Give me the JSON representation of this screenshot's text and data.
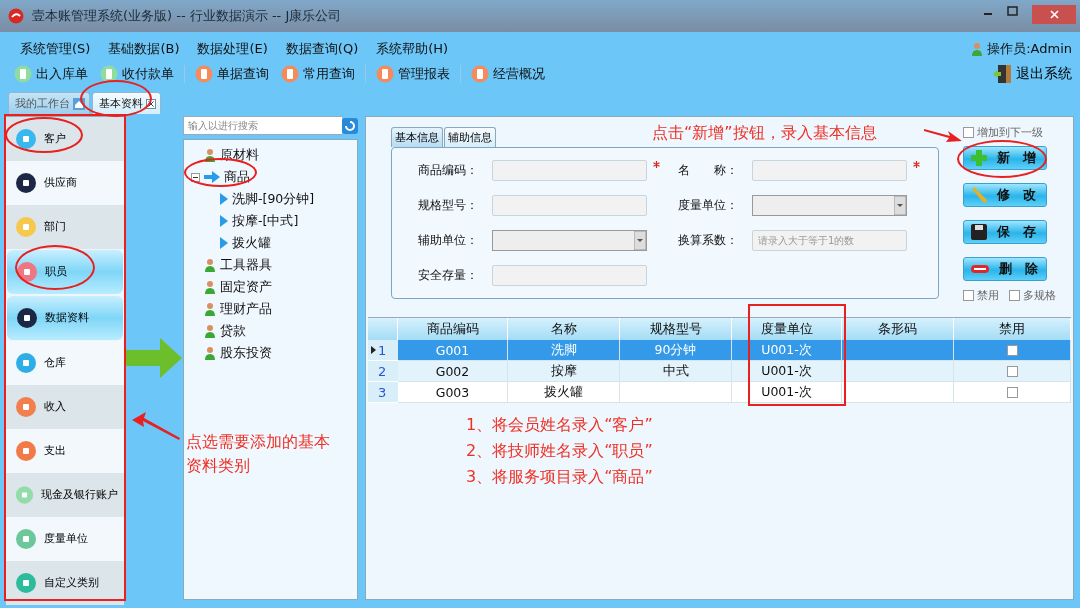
{
  "window": {
    "title": "壹本账管理系统(业务版) -- 行业数据演示 -- J康乐公司"
  },
  "menu": [
    "系统管理(S)",
    "基础数据(B)",
    "数据处理(E)",
    "数据查询(Q)",
    "系统帮助(H)"
  ],
  "toolbar": [
    {
      "label": "出入库单",
      "color": "#8fdca0"
    },
    {
      "label": "收付款单",
      "color": "#8fdca0"
    },
    {
      "label": "单据查询",
      "color": "#f58a5c"
    },
    {
      "label": "常用查询",
      "color": "#f58a5c"
    },
    {
      "label": "管理报表",
      "color": "#f58a5c"
    },
    {
      "label": "经营概况",
      "color": "#f58a5c"
    }
  ],
  "operator": "操作员:Admin",
  "exit": "退出系统",
  "tabs": [
    {
      "label": "我的工作台",
      "selected": false
    },
    {
      "label": "基本资料",
      "selected": true
    }
  ],
  "sidebar": {
    "items": [
      {
        "label": "客户",
        "selected": false,
        "color": "#38b8ee"
      },
      {
        "label": "供应商",
        "selected": false,
        "color": "#1b2745"
      },
      {
        "label": "部门",
        "selected": false,
        "color": "#f6c84c"
      },
      {
        "label": "职员",
        "selected": true,
        "color": "#ef7683"
      },
      {
        "label": "数据资料",
        "selected": true,
        "color": "#1b2745"
      },
      {
        "label": "仓库",
        "selected": false,
        "color": "#2eaee6"
      },
      {
        "label": "收入",
        "selected": false,
        "color": "#f2804e"
      },
      {
        "label": "支出",
        "selected": false,
        "color": "#f27a48"
      },
      {
        "label": "现金及银行账户",
        "selected": false,
        "color": "#92dbaa"
      },
      {
        "label": "度量单位",
        "selected": false,
        "color": "#6cc79a"
      },
      {
        "label": "自定义类别",
        "selected": false,
        "color": "#2dbb9e"
      }
    ]
  },
  "tree": {
    "search_placeholder": "输入以进行搜索",
    "items": [
      {
        "label": "原材料"
      },
      {
        "label": "商品",
        "expanded": true,
        "children": [
          {
            "label": "洗脚-[90分钟]"
          },
          {
            "label": "按摩-[中式]"
          },
          {
            "label": "拨火罐"
          }
        ]
      },
      {
        "label": "工具器具"
      },
      {
        "label": "固定资产"
      },
      {
        "label": "理财产品"
      },
      {
        "label": "贷款"
      },
      {
        "label": "股东投资"
      }
    ]
  },
  "form": {
    "tabs": [
      {
        "label": "基本信息",
        "selected": true
      },
      {
        "label": "辅助信息",
        "selected": false
      }
    ],
    "fields": [
      {
        "label": "商品编码：",
        "kind": "text",
        "required": true
      },
      {
        "label": "名　　称：",
        "kind": "text",
        "required": true
      },
      {
        "label": "规格型号：",
        "kind": "text",
        "required": false
      },
      {
        "label": "度量单位：",
        "kind": "select",
        "required": false
      },
      {
        "label": "辅助单位：",
        "kind": "select",
        "required": false
      },
      {
        "label": "换算系数：",
        "kind": "text",
        "required": false,
        "placeholder": "请录入大于等于1的数"
      },
      {
        "label": "安全存量：",
        "kind": "text",
        "required": false
      }
    ]
  },
  "actions": {
    "add_to_child": {
      "label": "增加到下一级",
      "checked": false
    },
    "buttons": [
      {
        "label": "新　增",
        "kind": "add"
      },
      {
        "label": "修　改",
        "kind": "edit"
      },
      {
        "label": "保　存",
        "kind": "save"
      },
      {
        "label": "删　除",
        "kind": "delete"
      }
    ],
    "options": [
      {
        "label": "禁用",
        "checked": false
      },
      {
        "label": "多规格",
        "checked": false
      }
    ]
  },
  "table": {
    "columns": [
      "商品编码",
      "名称",
      "规格型号",
      "度量单位",
      "条形码",
      "禁用"
    ],
    "rows": [
      {
        "number": "1",
        "code": "G001",
        "name": "洗脚",
        "spec": "90分钟",
        "unit": "U001-次",
        "disabled": false,
        "selected": true
      },
      {
        "number": "2",
        "code": "G002",
        "name": "按摩",
        "spec": "中式",
        "unit": "U001-次",
        "disabled": false,
        "selected": false
      },
      {
        "number": "3",
        "code": "G003",
        "name": "拨火罐",
        "unit": "U001-次",
        "disabled": false,
        "selected": false
      }
    ]
  },
  "annotations": {
    "button_hint": "点击“新增”按钮，录入基本信息",
    "category_hint": "点选需要添加的基本资料类别",
    "steps": [
      "1、将会员姓名录入“客户”",
      "2、将技师姓名录入“职员”",
      "3、将服务项目录入“商品”"
    ]
  }
}
